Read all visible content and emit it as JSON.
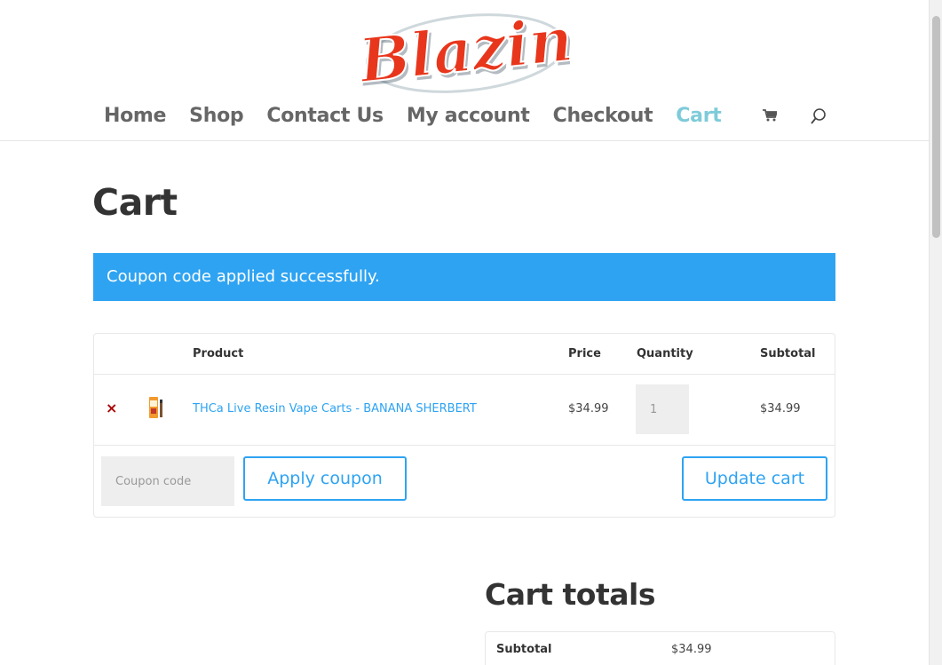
{
  "brand": {
    "logo_text": "Blazin"
  },
  "nav": {
    "items": [
      {
        "label": "Home"
      },
      {
        "label": "Shop"
      },
      {
        "label": "Contact Us"
      },
      {
        "label": "My account"
      },
      {
        "label": "Checkout"
      },
      {
        "label": "Cart",
        "active": true
      }
    ],
    "icons": [
      "cart-icon",
      "search-icon"
    ]
  },
  "page": {
    "title": "Cart"
  },
  "notice": {
    "message": "Coupon code applied successfully."
  },
  "cart": {
    "headers": {
      "product": "Product",
      "price": "Price",
      "quantity": "Quantity",
      "subtotal": "Subtotal"
    },
    "items": [
      {
        "remove_icon": "×",
        "name": "THCa Live Resin Vape Carts - BANANA SHERBERT",
        "price": "$34.99",
        "quantity": "1",
        "subtotal": "$34.99"
      }
    ],
    "coupon": {
      "placeholder": "Coupon code",
      "apply_label": "Apply coupon"
    },
    "update_label": "Update cart"
  },
  "totals": {
    "title": "Cart totals",
    "rows": [
      {
        "label": "Subtotal",
        "value": "$34.99"
      }
    ]
  },
  "colors": {
    "accent": "#2ea3f2",
    "nav_active": "#7ecbd9",
    "logo": "#e8361c"
  }
}
